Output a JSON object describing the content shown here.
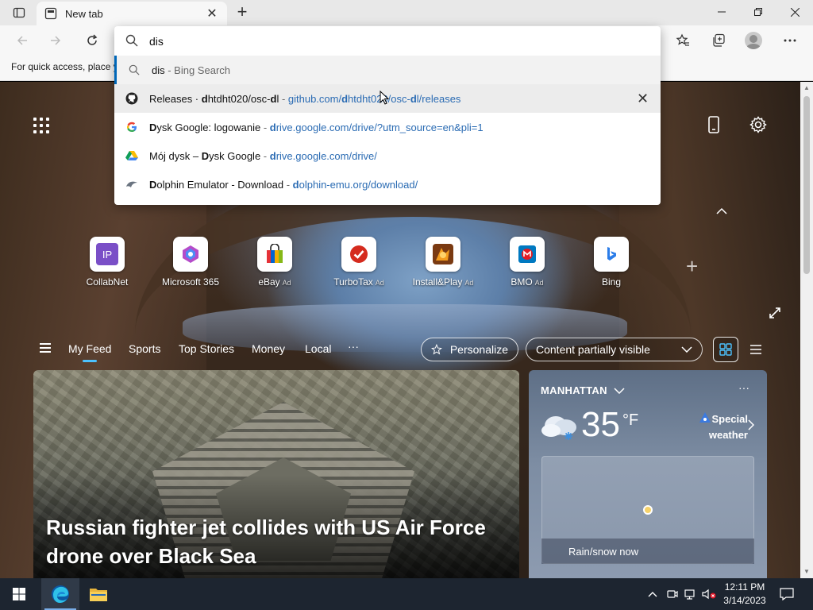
{
  "browser": {
    "tab_title": "New tab",
    "favorites_hint": "For quick access, place y"
  },
  "omnibox": {
    "query": "dis",
    "suggestions": [
      {
        "type": "search",
        "prefix": "dis",
        "rest": " - Bing Search",
        "icon": "search-icon"
      },
      {
        "type": "history",
        "title_pre": "Releases · ",
        "title_bold1": "d",
        "title_mid": "htdht020/osc-",
        "title_bold2": "d",
        "title_end": "l",
        "url_bold": "d",
        "url_pre": "github.com/",
        "url_rest1": "htdht020/osc-",
        "url_bold2": "d",
        "url_end": "l/releases",
        "icon": "github-icon"
      },
      {
        "type": "history",
        "title_bold": "D",
        "title_rest": "ysk Google: logowanie",
        "url_bold": "d",
        "url_rest": "rive.google.com/drive/?utm_source=en&pli=1",
        "icon": "google-icon"
      },
      {
        "type": "history",
        "title_pre": "Mój dysk – ",
        "title_bold": "D",
        "title_rest": "ysk Google",
        "url_bold": "d",
        "url_rest": "rive.google.com/drive/",
        "icon": "google-drive-icon"
      },
      {
        "type": "history",
        "title_bold": "D",
        "title_rest": "olphin Emulator - Download",
        "url_bold": "d",
        "url_rest": "olphin-emu.org/download/",
        "icon": "dolphin-icon"
      }
    ],
    "separator": " - "
  },
  "quick_links": [
    {
      "label": "CollabNet",
      "ad": "",
      "color": "#7a4fc7"
    },
    {
      "label": "Microsoft 365",
      "ad": "",
      "color": "#d65aa6"
    },
    {
      "label": "eBay",
      "ad": "Ad",
      "color": "#e53238"
    },
    {
      "label": "TurboTax",
      "ad": "Ad",
      "color": "#d52b1e"
    },
    {
      "label": "Install&Play",
      "ad": "Ad",
      "color": "#c94a1c"
    },
    {
      "label": "BMO",
      "ad": "Ad",
      "color": "#0079c1"
    },
    {
      "label": "Bing",
      "ad": "",
      "color": "#2b7de9"
    }
  ],
  "feed_nav": {
    "items": [
      "My Feed",
      "Sports",
      "Top Stories",
      "Money",
      "Local"
    ],
    "more": "···",
    "personalize": "Personalize",
    "content_visibility": "Content partially visible"
  },
  "hero": {
    "headline": "Russian fighter jet collides with US Air Force drone over Black Sea"
  },
  "weather": {
    "location": "MANHATTAN",
    "temperature": "35",
    "unit": "°F",
    "special_line1": "Special",
    "special_line2": "weather",
    "map_label": "Rain/snow now"
  },
  "taskbar": {
    "time": "12:11 PM",
    "date": "3/14/2023"
  }
}
